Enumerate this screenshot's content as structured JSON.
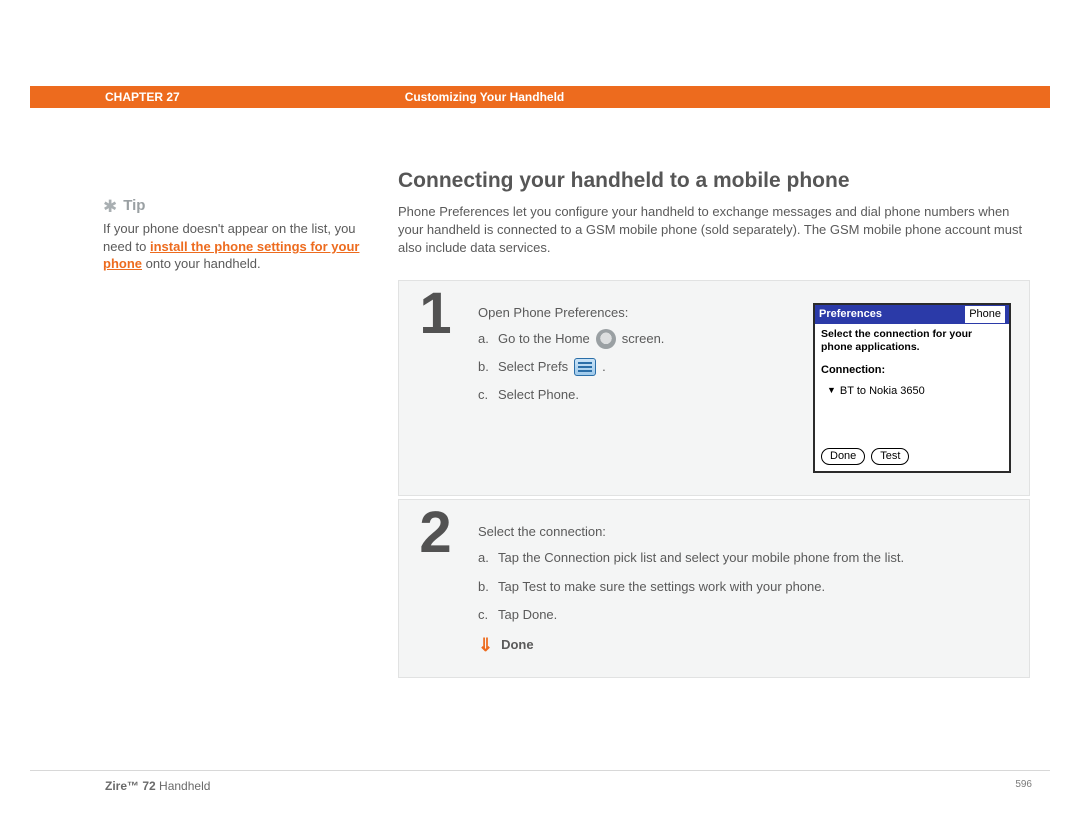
{
  "header": {
    "chapter_label": "CHAPTER 27",
    "section_title": "Customizing Your Handheld"
  },
  "sidebar": {
    "tip_label": "Tip",
    "tip_pre": "If your phone doesn't appear on the list, you need to ",
    "tip_link": "install the phone settings for your phone",
    "tip_post": " onto your handheld."
  },
  "main": {
    "title": "Connecting your handheld to a mobile phone",
    "intro": "Phone Preferences let you configure your handheld to exchange messages and dial phone numbers when your handheld is connected to a GSM mobile phone (sold separately). The GSM mobile phone account must also include data services."
  },
  "steps": [
    {
      "num": "1",
      "lead": "Open Phone Preferences:",
      "a_pre": "Go to the Home",
      "a_post": "screen.",
      "b_pre": "Select Prefs",
      "b_post": ".",
      "c": "Select Phone."
    },
    {
      "num": "2",
      "lead": "Select the connection:",
      "a": "Tap the Connection pick list and select your mobile phone from the list.",
      "b": "Tap Test to make sure the settings work with your phone.",
      "c": "Tap Done.",
      "done": "Done"
    }
  ],
  "palm": {
    "title_left": "Preferences",
    "title_right": "Phone",
    "instruction": "Select the connection for your phone applications.",
    "conn_label": "Connection:",
    "conn_value": "BT to Nokia 3650",
    "btn_done": "Done",
    "btn_test": "Test"
  },
  "footer": {
    "product_bold": "Zire™ 72",
    "product_rest": " Handheld",
    "page": "596"
  }
}
